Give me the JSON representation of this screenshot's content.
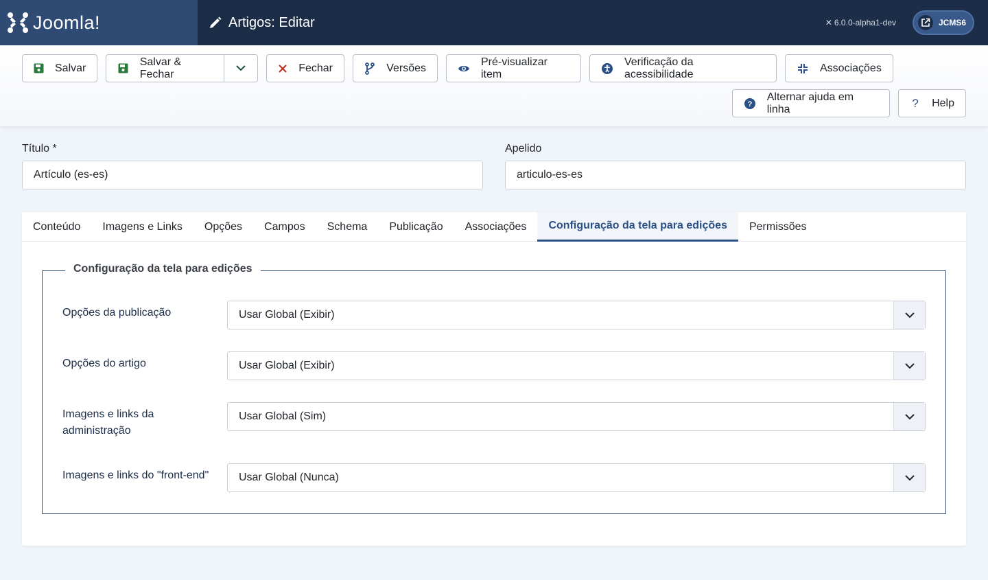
{
  "header": {
    "logo_text": "Joomla!",
    "title": "Artigos: Editar",
    "version": "6.0.0-alpha1-dev",
    "site_button": "JCMS6"
  },
  "toolbar": {
    "save": "Salvar",
    "save_close": "Salvar & Fechar",
    "close": "Fechar",
    "versions": "Versões",
    "preview": "Pré-visualizar item",
    "accessibility": "Verificação da acessibilidade",
    "associations": "Associações",
    "toggle_help": "Alternar ajuda em linha",
    "help": "Help"
  },
  "form": {
    "title_label": "Título *",
    "title_value": "Artículo (es-es)",
    "alias_label": "Apelido",
    "alias_value": "articulo-es-es"
  },
  "tabs": [
    {
      "label": "Conteúdo"
    },
    {
      "label": "Imagens e Links"
    },
    {
      "label": "Opções"
    },
    {
      "label": "Campos"
    },
    {
      "label": "Schema"
    },
    {
      "label": "Publicação"
    },
    {
      "label": "Associações"
    },
    {
      "label": "Configuração da tela para edições",
      "active": true
    },
    {
      "label": "Permissões"
    }
  ],
  "fieldset": {
    "legend": "Configuração da tela para edições",
    "rows": [
      {
        "label": "Opções da publicação",
        "value": "Usar Global (Exibir)"
      },
      {
        "label": "Opções do artigo",
        "value": "Usar Global (Exibir)"
      },
      {
        "label": "Imagens e links da administração",
        "value": "Usar Global (Sim)"
      },
      {
        "label": "Imagens e links do \"front-end\"",
        "value": "Usar Global (Nunca)"
      }
    ]
  },
  "colors": {
    "header_bg": "#1c2d48",
    "logo_bg": "#2f4a73",
    "accent": "#2a5088",
    "save_icon": "#2a7a3b",
    "close_icon": "#c4281c",
    "primary_icon": "#2a5088"
  },
  "icons": {
    "logo": "joomla-logo-icon",
    "title": "pencil-icon",
    "version": "joomla-small-icon",
    "site": "external-link-icon",
    "save": "floppy-disk-icon",
    "close": "x-icon",
    "versions": "code-branch-icon",
    "preview": "eye-icon",
    "accessibility": "universal-access-icon",
    "associations": "compress-icon",
    "toggle_help": "question-circle-icon",
    "help": "question-icon",
    "select": "chevron-down-icon"
  }
}
